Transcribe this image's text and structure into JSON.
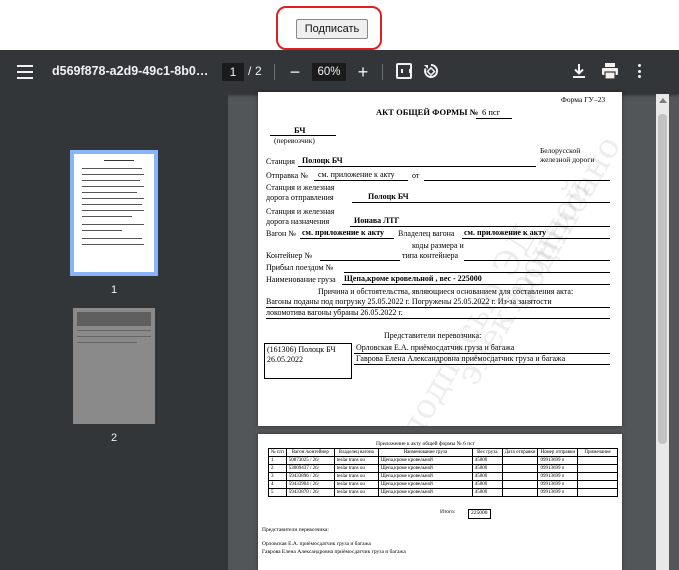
{
  "sign_button": {
    "label": "Подписать"
  },
  "viewer": {
    "title": "d569f878-a2d9-49c1-8b07-37...",
    "current_page": "1",
    "page_separator": "/",
    "total_pages": "2",
    "zoom": "60%",
    "minus": "−",
    "plus": "+",
    "icons": [
      "menu-icon",
      "zoom-out-icon",
      "zoom-in-icon",
      "fit-page-icon",
      "rotate-icon",
      "download-icon",
      "print-icon",
      "more-icon"
    ]
  },
  "sidebar": {
    "thumbnails": [
      {
        "label": "1",
        "selected": true
      },
      {
        "label": "2",
        "selected": false
      }
    ]
  },
  "page1": {
    "form_label": "Форма ГУ–23",
    "title_prefix": "АКТ ОБЩЕЙ ФОРМЫ №",
    "title_number": "6 псг",
    "carrier_value": "БЧ",
    "carrier_label": "(перевозчик)",
    "railway": "Белорусской",
    "railway2": "железной дороги",
    "station_label": "Станция",
    "station_value": "Полоцк БЧ",
    "dispatch_label": "Отправка №",
    "dispatch_value": "см. приложение к акту",
    "dispatch_from": "от",
    "origin_label1": "Станция и железная",
    "origin_label2": "дорога отправления",
    "origin_value": "Полоцк БЧ",
    "dest_label1": "Станция и железная",
    "dest_label2": "дорога назначения",
    "dest_value": "Ионава ЛТГ",
    "wagon_label": "Вагон №",
    "wagon_value": "см. приложение к акту",
    "owner_label": "Владелец вагона",
    "owner_value": "см. приложение к акту",
    "codes_label": "коды размера и",
    "container_label": "Контейнер №",
    "container_type": "типа контейнера",
    "train_label": "Прибыл поездом №",
    "cargo_label": "Наименование груза",
    "cargo_value": "Щепа,кроме кровельной , вес - 225000",
    "reason_label": "Причина и обстоятельства, являющиеся основанием для составления акта:",
    "reason_line1": "Вагоны поданы под погрузку 25.05.2022 г. Погружены 25.05.2022 г. Из-за занятости",
    "reason_line2": "локомотива вагоны убраны  26.05.2022 г.",
    "reps_label": "Представители перевозчика:",
    "stamp_line1": "(161306) Полоцк БЧ",
    "stamp_line2": "26.05.2022",
    "rep1": "Орловская Е.А.   приёмосдатчик груза и багажа",
    "rep2": "Гаврова Елена Александровна   приёмосдатчик груза и багажа",
    "watermark1": "подписано",
    "watermark2": "электронной",
    "watermark3": "подписью ЭД"
  },
  "page2": {
    "title": "Приложение к акту общей формы № 6 псг",
    "headers": [
      "№ п/п",
      "Вагон /контейнер",
      "Владелец вагона",
      "Наименование груза",
      "Вес груза",
      "Дата отправки",
      "Номер отправки",
      "Примечание"
    ],
    "rows": [
      [
        "1",
        "50873025 / 26/",
        "teslar trans ou",
        "Щепа,кроме кровельной",
        "45000",
        "",
        "09913699 о",
        ""
      ],
      [
        "2",
        "53009437 / 26/",
        "teslar trans ou",
        "Щепа,кроме кровельной",
        "45000",
        "",
        "09913699 о",
        ""
      ],
      [
        "3",
        "59433896 / 26/",
        "teslar trans ou",
        "Щепа,кроме кровельной",
        "45000",
        "",
        "09913699 о",
        ""
      ],
      [
        "4",
        "59433904 / 26/",
        "teslar trans ou",
        "Щепа,кроме кровельной",
        "45000",
        "",
        "09913699 о",
        ""
      ],
      [
        "5",
        "59433870 / 26/",
        "teslar trans ou",
        "Щепа,кроме кровельной",
        "45000",
        "",
        "09913699 о",
        ""
      ]
    ],
    "total_label": "Итого:",
    "total_value": "225000",
    "reps_label": "Представители перевозчика:",
    "rep1": "Орловская Е.А.   приёмосдатчик груза и багажа",
    "rep2": "Гаврова Елена Александровна   приёмосдатчик груза и багажа"
  }
}
